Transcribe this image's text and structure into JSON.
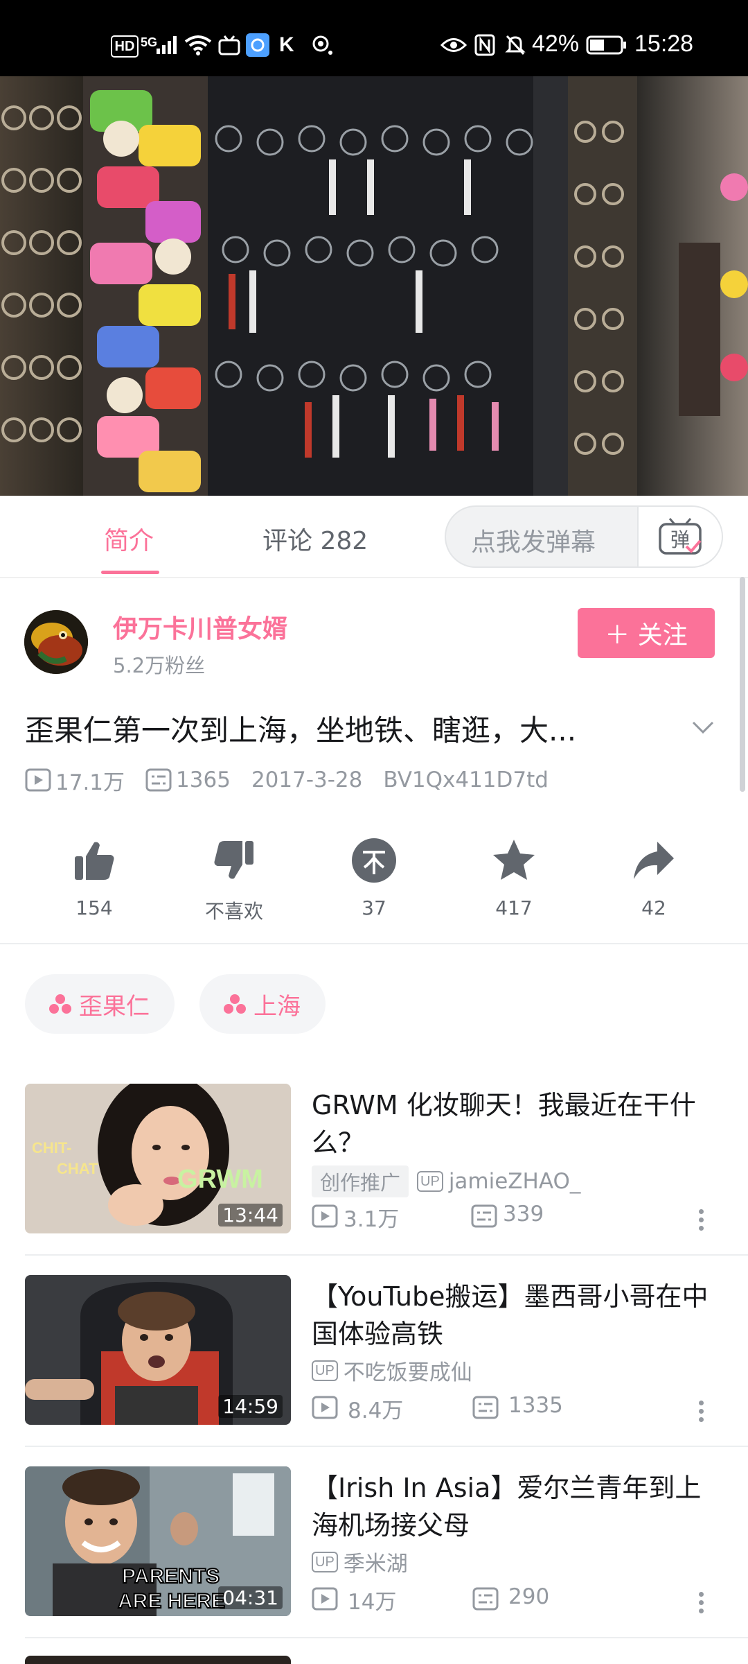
{
  "status_bar": {
    "network": "HD",
    "signal": "5G",
    "battery_percent": "42%",
    "time": "15:28"
  },
  "tabs": {
    "intro": "简介",
    "comments": "评论 282",
    "danmaku_placeholder": "点我发弹幕",
    "danmaku_button": "弹"
  },
  "uploader": {
    "name": "伊万卡川普女婿",
    "fans": "5.2万粉丝",
    "follow_label": "＋ 关注"
  },
  "video": {
    "title": "歪果仁第一次到上海，坐地铁、瞎逛，大...",
    "views": "17.1万",
    "danmaku_count": "1365",
    "date": "2017-3-28",
    "bvid": "BV1Qx411D7td"
  },
  "actions": [
    {
      "name": "like",
      "label": "154"
    },
    {
      "name": "dislike",
      "label": "不喜欢"
    },
    {
      "name": "coin",
      "label": "37"
    },
    {
      "name": "favorite",
      "label": "417"
    },
    {
      "name": "share",
      "label": "42"
    }
  ],
  "tags": [
    "歪果仁",
    "上海"
  ],
  "recommendations": [
    {
      "title": "GRWM 化妆聊天！我最近在干什么？",
      "promo": "创作推广",
      "up_badge": "UP",
      "uploader": "jamieZHAO_",
      "views": "3.1万",
      "danmaku": "339",
      "duration": "13:44",
      "thumb_text_1": "CHIT-",
      "thumb_text_2": "CHAT",
      "thumb_text_3": "GRWM"
    },
    {
      "title": "【YouTube搬运】墨西哥小哥在中国体验高铁",
      "up_badge": "UP",
      "uploader": "不吃饭要成仙",
      "views": "8.4万",
      "danmaku": "1335",
      "duration": "14:59"
    },
    {
      "title": "【Irish In Asia】爱尔兰青年到上海机场接父母",
      "up_badge": "UP",
      "uploader": "季米湖",
      "views": "14万",
      "danmaku": "290",
      "duration": "04:31",
      "thumb_text_1": "PARENTS",
      "thumb_text_2": "ARE HERE"
    }
  ],
  "colors": {
    "accent": "#fb7299",
    "text_secondary": "#9499a0"
  }
}
